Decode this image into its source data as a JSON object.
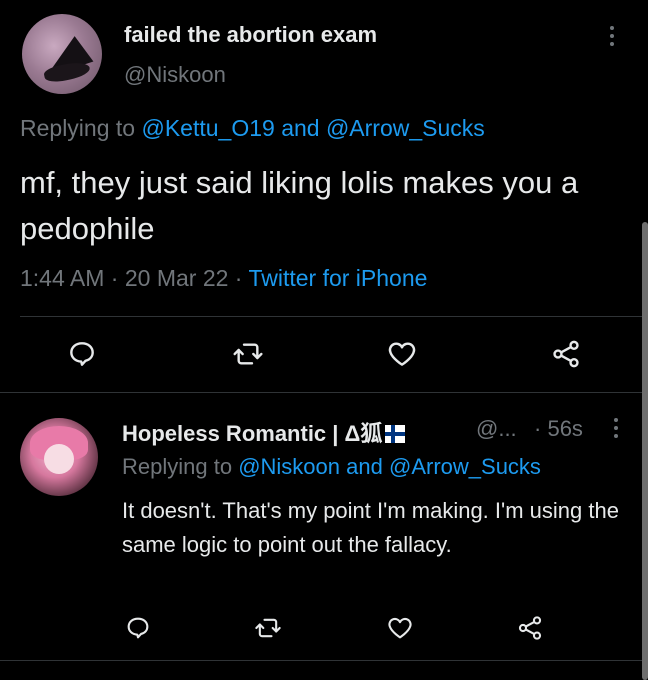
{
  "tweet1": {
    "display_name": "failed the abortion exam",
    "handle": "@Niskoon",
    "replying_prefix": "Replying to",
    "replying_user1": "@Kettu_O19",
    "replying_and": "and",
    "replying_user2": "@Arrow_Sucks",
    "text": "mf, they just said liking lolis makes you a pedophile",
    "time": "1:44 AM",
    "sep1": "·",
    "date": "20 Mar 22",
    "sep2": "·",
    "source": "Twitter for iPhone",
    "icons": [
      "reply-icon",
      "retweet-icon",
      "like-icon",
      "share-icon"
    ]
  },
  "tweet2": {
    "display_name": "Hopeless Romantic | Δ狐",
    "handle": "@...",
    "sep": "·",
    "time": "56s",
    "replying_prefix": "Replying to",
    "replying_user1": "@Niskoon",
    "replying_and": "and",
    "replying_user2": "@Arrow_Sucks",
    "text": "It doesn't. That's my point I'm making. I'm using the same logic to point out the fallacy.",
    "icons": [
      "reply-icon",
      "retweet-icon",
      "like-icon",
      "share-icon"
    ]
  },
  "colors": {
    "background": "#000000",
    "text": "#e7e9ea",
    "muted": "#71767b",
    "link": "#1d9bf0",
    "divider": "#2f3336"
  }
}
